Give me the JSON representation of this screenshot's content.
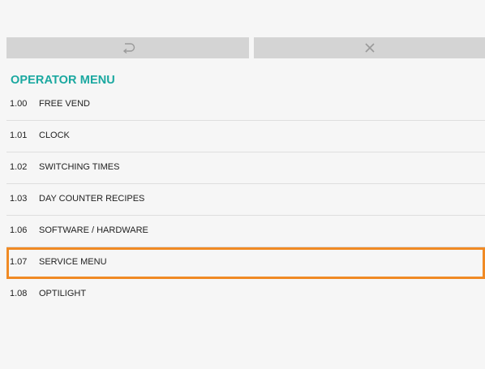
{
  "toolbar": {
    "back_icon": "back-arrow-icon",
    "close_icon": "close-icon"
  },
  "menu": {
    "title": "OPERATOR MENU",
    "items": [
      {
        "num": "1.00",
        "label": "FREE VEND",
        "selected": false
      },
      {
        "num": "1.01",
        "label": "CLOCK",
        "selected": false
      },
      {
        "num": "1.02",
        "label": "SWITCHING TIMES",
        "selected": false
      },
      {
        "num": "1.03",
        "label": "DAY COUNTER RECIPES",
        "selected": false
      },
      {
        "num": "1.06",
        "label": "SOFTWARE / HARDWARE",
        "selected": false
      },
      {
        "num": "1.07",
        "label": "SERVICE MENU",
        "selected": true
      },
      {
        "num": "1.08",
        "label": "OPTILIGHT",
        "selected": false
      }
    ]
  },
  "colors": {
    "accent": "#1aa8a0",
    "selection": "#f08a24",
    "toolbar": "#d4d4d4",
    "background": "#f6f6f6"
  }
}
